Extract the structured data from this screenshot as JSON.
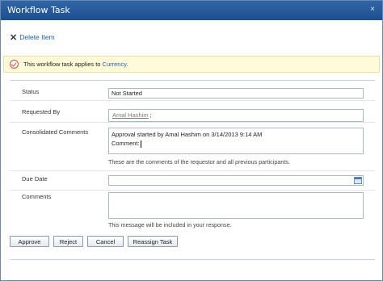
{
  "window": {
    "title": "Workflow Task",
    "close_symbol": "×"
  },
  "toolbar": {
    "delete_label": "Delete Item"
  },
  "info": {
    "message_prefix": "This workflow task applies to ",
    "link_text": "Currency",
    "message_suffix": "."
  },
  "form": {
    "status": {
      "label": "Status",
      "value": "Not Started"
    },
    "requested_by": {
      "label": "Requested By",
      "value": "Amal Hashim",
      "suffix": " ;"
    },
    "consolidated_comments": {
      "label": "Consolidated Comments",
      "line1": "Approval started by Amal Hashim on 3/14/2013 9:14 AM",
      "line2": "Comment:",
      "hint": "These are the comments of the requestor and all previous participants."
    },
    "due_date": {
      "label": "Due Date",
      "value": ""
    },
    "comments": {
      "label": "Comments",
      "value": "",
      "hint": "This message will be included in your response."
    }
  },
  "buttons": {
    "approve": "Approve",
    "reject": "Reject",
    "cancel": "Cancel",
    "reassign": "Reassign Task"
  },
  "colors": {
    "title_bar": "#1d4f8f",
    "link": "#1f5fa8",
    "info_bar": "#fffbd9"
  }
}
